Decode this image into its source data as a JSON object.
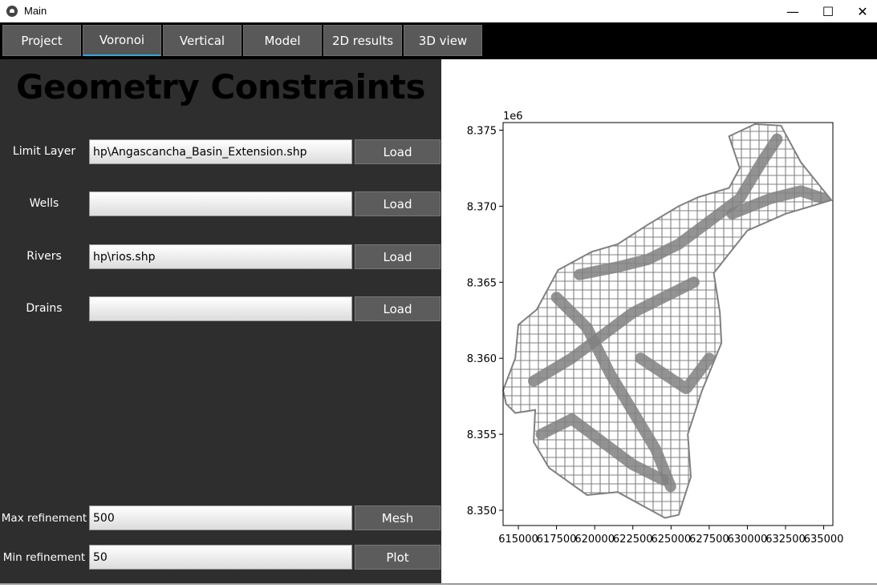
{
  "window": {
    "title": "Main",
    "controls": {
      "minimize": "—",
      "maximize": "☐",
      "close": "✕"
    }
  },
  "tabs": [
    {
      "label": "Project"
    },
    {
      "label": "Voronoi",
      "active": true
    },
    {
      "label": "Vertical"
    },
    {
      "label": "Model"
    },
    {
      "label": "2D results"
    },
    {
      "label": "3D view"
    }
  ],
  "panel": {
    "heading": "Geometry Constraints",
    "rows": [
      {
        "label": "Limit Layer",
        "value": "hp\\Angascancha_Basin_Extension.shp",
        "button": "Load"
      },
      {
        "label": "Wells",
        "value": "",
        "button": "Load"
      },
      {
        "label": "Rivers",
        "value": "hp\\rios.shp",
        "button": "Load"
      },
      {
        "label": "Drains",
        "value": "",
        "button": "Load"
      }
    ],
    "max_refinement": {
      "label": "Max refinement",
      "value": "500",
      "button": "Mesh"
    },
    "min_refinement": {
      "label": "Min refinement",
      "value": "50",
      "button": "Plot"
    }
  },
  "colors": {
    "accent": "#33a7d8",
    "panel_bg": "#2e2e2e",
    "mesh": "#808080"
  },
  "chart_data": {
    "type": "mesh",
    "offset_label": "1e6",
    "x_ticks": [
      615000,
      617500,
      620000,
      622500,
      625000,
      627500,
      630000,
      632500,
      635000
    ],
    "x_tick_labels": [
      "615000",
      "617500",
      "620000",
      "622500",
      "625000",
      "627500",
      "630000",
      "632500",
      "635000"
    ],
    "y_ticks": [
      8.35,
      8.355,
      8.36,
      8.365,
      8.37,
      8.375
    ],
    "y_tick_labels": [
      "8.350",
      "8.355",
      "8.360",
      "8.365",
      "8.370",
      "8.375"
    ],
    "xlim": [
      614000,
      635600
    ],
    "ylim": [
      8.349,
      8.3755
    ],
    "grid": false,
    "boundary": [
      [
        614000,
        8.3579
      ],
      [
        614800,
        8.36
      ],
      [
        615000,
        8.3622
      ],
      [
        616200,
        8.3632
      ],
      [
        617600,
        8.3658
      ],
      [
        619800,
        8.367
      ],
      [
        621500,
        8.3675
      ],
      [
        623500,
        8.3688
      ],
      [
        625500,
        8.37
      ],
      [
        626800,
        8.3706
      ],
      [
        628800,
        8.3712
      ],
      [
        629500,
        8.3725
      ],
      [
        628800,
        8.3746
      ],
      [
        630500,
        8.3754
      ],
      [
        632200,
        8.3753
      ],
      [
        633500,
        8.3729
      ],
      [
        635500,
        8.3704
      ],
      [
        632500,
        8.3695
      ],
      [
        630000,
        8.3684
      ],
      [
        627800,
        8.3656
      ],
      [
        628200,
        8.363
      ],
      [
        628300,
        8.361
      ],
      [
        627000,
        8.3578
      ],
      [
        626100,
        8.355
      ],
      [
        626300,
        8.3522
      ],
      [
        625500,
        8.3497
      ],
      [
        624600,
        8.3495
      ],
      [
        621500,
        8.3512
      ],
      [
        619500,
        8.351
      ],
      [
        617000,
        8.3528
      ],
      [
        616000,
        8.3545
      ],
      [
        616100,
        8.3566
      ],
      [
        614800,
        8.3564
      ],
      [
        614200,
        8.357
      ]
    ]
  }
}
